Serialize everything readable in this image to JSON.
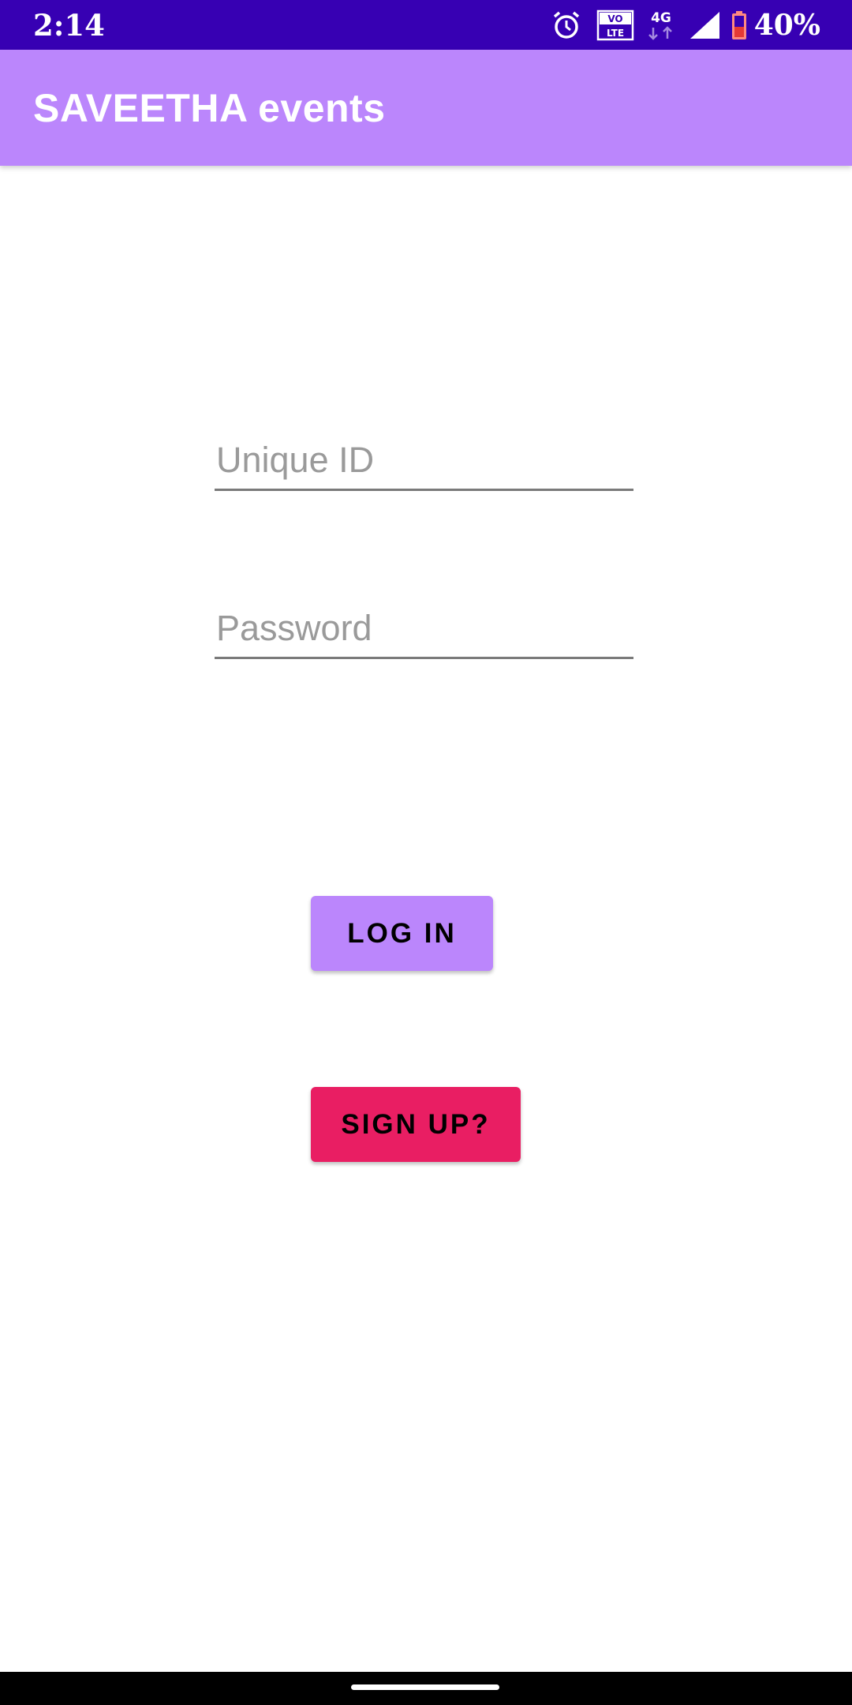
{
  "status_bar": {
    "time": "2:14",
    "volte_top": "VO",
    "volte_bottom": "LTE",
    "network": "4G",
    "battery_percent": "40%",
    "colors": {
      "background": "#3700B3"
    }
  },
  "app_bar": {
    "title": "SAVEETHA events",
    "colors": {
      "background": "#BB86FC"
    }
  },
  "form": {
    "unique_id": {
      "placeholder": "Unique ID",
      "value": ""
    },
    "password": {
      "placeholder": "Password",
      "value": ""
    },
    "login_label": "LOG IN",
    "signup_label": "SIGN UP?",
    "colors": {
      "login": "#BB86FC",
      "signup": "#E91E63"
    }
  },
  "icons": [
    "alarm-icon",
    "volte-icon",
    "network-4g-icon",
    "signal-icon",
    "battery-icon"
  ]
}
